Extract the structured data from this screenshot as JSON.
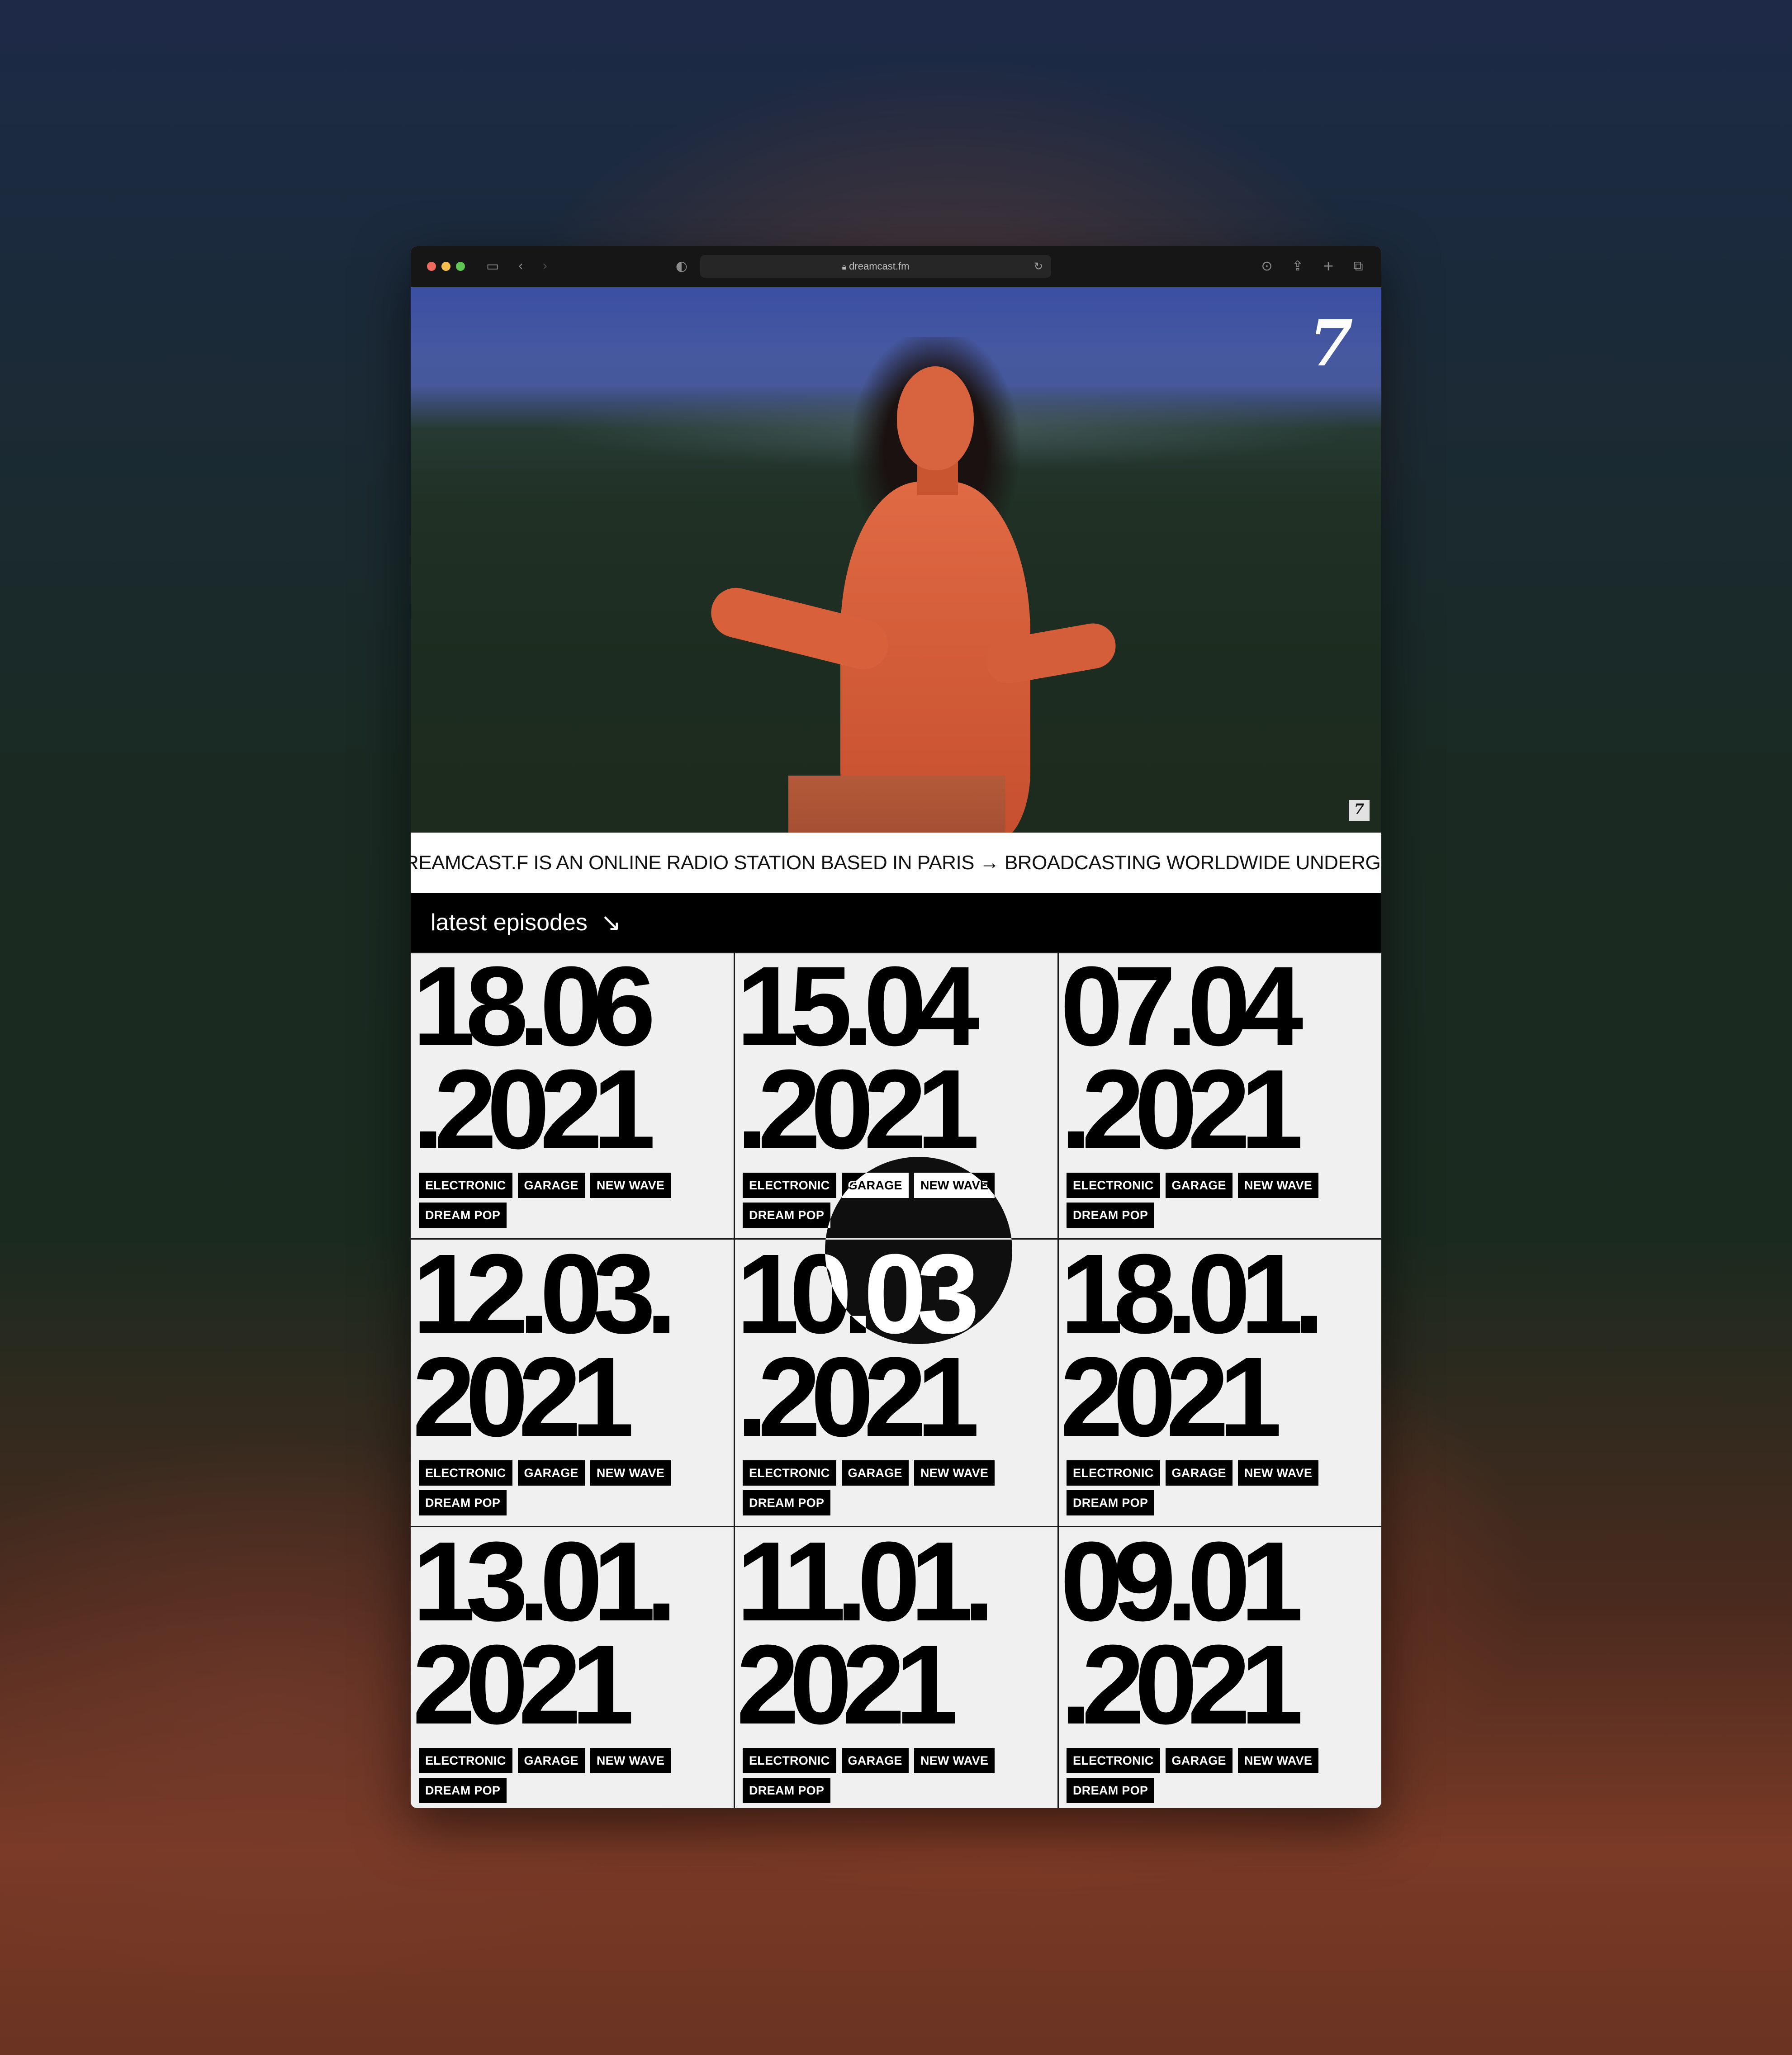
{
  "browser": {
    "url": "dreamcast.fm"
  },
  "hero": {
    "logo": "7",
    "badge": "7"
  },
  "marquee": {
    "text": "REAMCAST.F IS AN ONLINE RADIO STATION BASED IN PARIS → BROADCASTING WORLDWIDE UNDERGRO"
  },
  "section": {
    "title": "latest episodes",
    "arrow_icon": "arrow-down-right-icon"
  },
  "episodes": [
    {
      "date": "18.06\n.2021",
      "tags": [
        "ELECTRONIC",
        "GARAGE",
        "NEW WAVE",
        "DREAM POP"
      ]
    },
    {
      "date": "15.04\n.2021",
      "tags": [
        "ELECTRONIC",
        "GARAGE",
        "NEW WAVE",
        "DREAM POP"
      ]
    },
    {
      "date": "07.04\n.2021",
      "tags": [
        "ELECTRONIC",
        "GARAGE",
        "NEW WAVE",
        "DREAM POP"
      ]
    },
    {
      "date": "12.03.\n2021",
      "tags": [
        "ELECTRONIC",
        "GARAGE",
        "NEW WAVE",
        "DREAM POP"
      ]
    },
    {
      "date": "10.03\n.2021",
      "tags": [
        "ELECTRONIC",
        "GARAGE",
        "NEW WAVE",
        "DREAM POP"
      ]
    },
    {
      "date": "18.01.\n2021",
      "tags": [
        "ELECTRONIC",
        "GARAGE",
        "NEW WAVE",
        "DREAM POP"
      ]
    },
    {
      "date": "13.01.\n2021",
      "tags": [
        "ELECTRONIC",
        "GARAGE",
        "NEW WAVE",
        "DREAM POP"
      ]
    },
    {
      "date": "11.01.\n2021",
      "tags": [
        "ELECTRONIC",
        "GARAGE",
        "NEW WAVE",
        "DREAM POP"
      ]
    },
    {
      "date": "09.01\n.2021",
      "tags": [
        "ELECTRONIC",
        "GARAGE",
        "NEW WAVE",
        "DREAM POP"
      ]
    }
  ]
}
